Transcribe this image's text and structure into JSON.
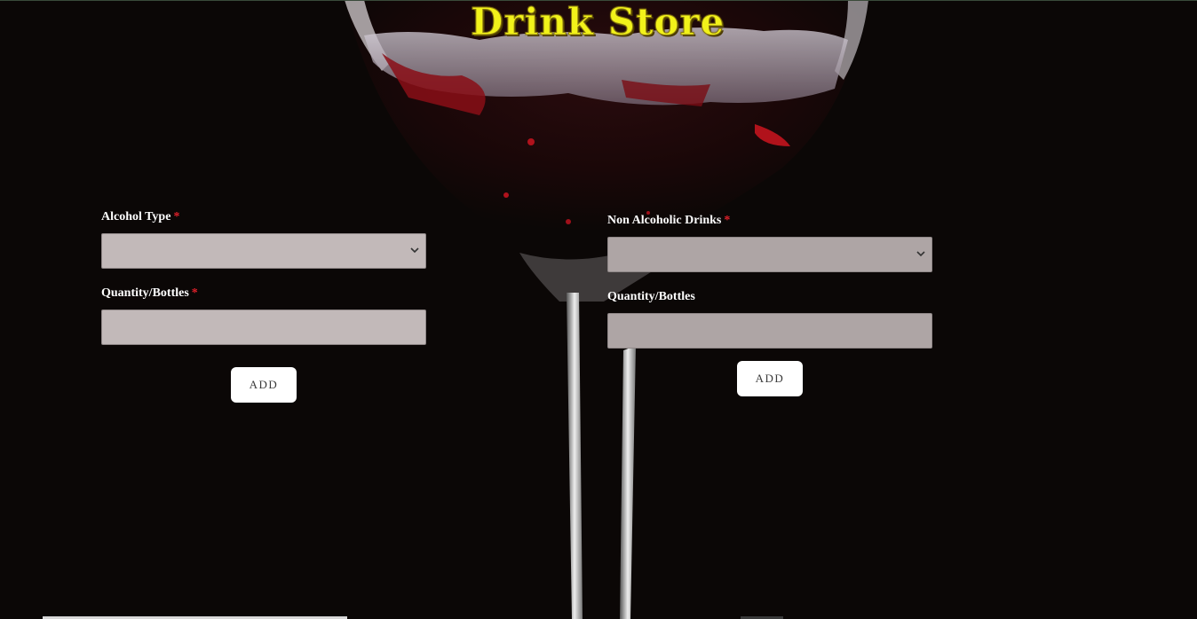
{
  "header": {
    "title": "Drink Store"
  },
  "alcohol_form": {
    "type_label": "Alcohol Type",
    "type_required_mark": "*",
    "type_selected": "",
    "quantity_label": "Quantity/Bottles",
    "quantity_required_mark": "*",
    "quantity_value": "",
    "add_label": "ADD"
  },
  "non_alcohol_form": {
    "type_label": "Non Alcoholic Drinks",
    "type_required_mark": "*",
    "type_selected": "",
    "quantity_label": "Quantity/Bottles",
    "quantity_value": "",
    "add_label": "ADD"
  },
  "background": {
    "image": "wine-glass-photo"
  },
  "colors": {
    "title": "#f2f21a",
    "required": "#e0202a",
    "input_bg": "#c2b9b9",
    "button_bg": "#ffffff",
    "page_bg": "#0b0706"
  }
}
